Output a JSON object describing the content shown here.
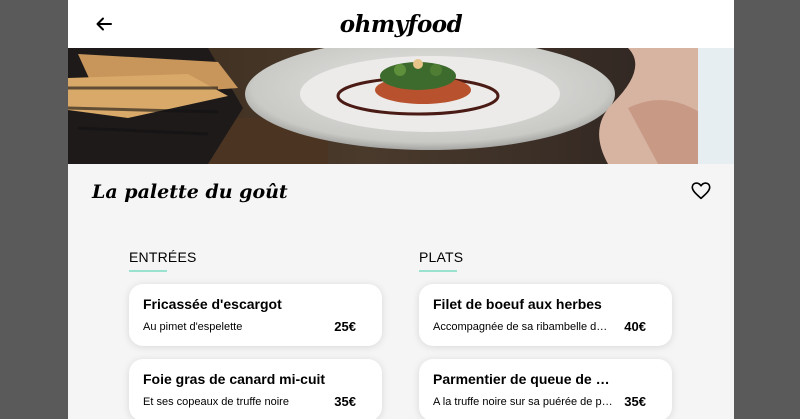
{
  "header": {
    "logo": "ohmyfood"
  },
  "restaurant": {
    "name": "La palette du goût"
  },
  "sections": [
    {
      "title": "ENTRÉES",
      "items": [
        {
          "name": "Fricassée d'escargot",
          "description": "Au pimet d'espelette",
          "price": "25€"
        },
        {
          "name": "Foie gras de canard mi-cuit",
          "description": "Et ses copeaux de truffe noire",
          "price": "35€"
        }
      ]
    },
    {
      "title": "PLATS",
      "items": [
        {
          "name": "Filet de boeuf aux herbes",
          "description": "Accompagnée de sa ribambelle de légumes",
          "price": "40€"
        },
        {
          "name": "Parmentier de queue de boeuf",
          "description": "A la truffe noire sur sa puérée de pommes de terre",
          "price": "35€"
        }
      ]
    }
  ],
  "icons": {
    "back": "arrow-left-icon",
    "favorite": "heart-icon"
  },
  "colors": {
    "accent_underline": "#99e2d0",
    "page_background": "#f5f5f5",
    "outer_background": "#5a5a5a"
  }
}
